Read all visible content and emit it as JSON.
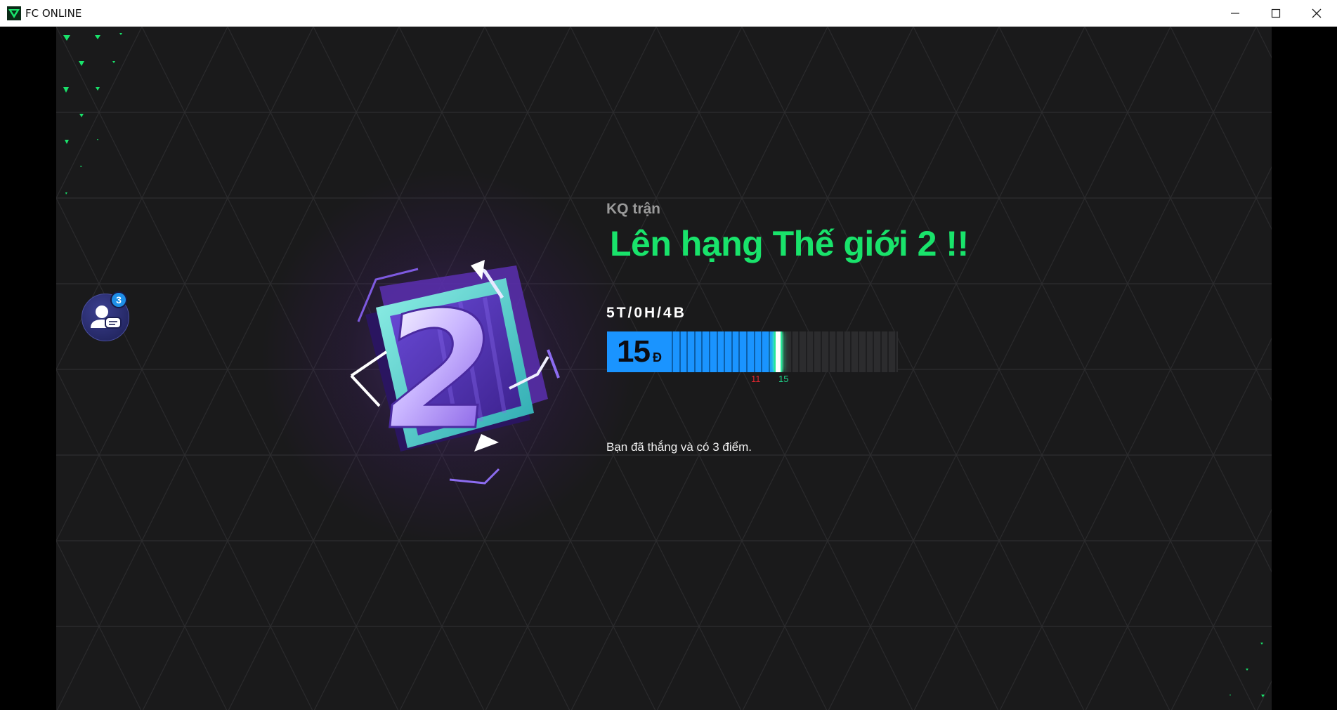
{
  "window": {
    "title": "FC ONLINE",
    "controls": [
      "minimize",
      "maximize",
      "close"
    ]
  },
  "chat": {
    "icon": "friends-chat-icon",
    "count": "3"
  },
  "result": {
    "label": "KQ trận",
    "title": "Lên hạng Thế giới 2 !!",
    "record": "5T/0H/4B",
    "points": "15",
    "points_unit": "Đ",
    "progress_min_label": "11",
    "progress_current_label": "15",
    "progress_fraction": 0.6,
    "message": "Bạn đã thắng và có 3 điểm."
  },
  "badge": {
    "rank_number": "2",
    "icon": "rank-badge-world-2"
  },
  "colors": {
    "accent_green": "#19e36b",
    "bar_blue": "#1a94ff",
    "background": "#1a1a1b",
    "min_red": "#e0262f"
  }
}
